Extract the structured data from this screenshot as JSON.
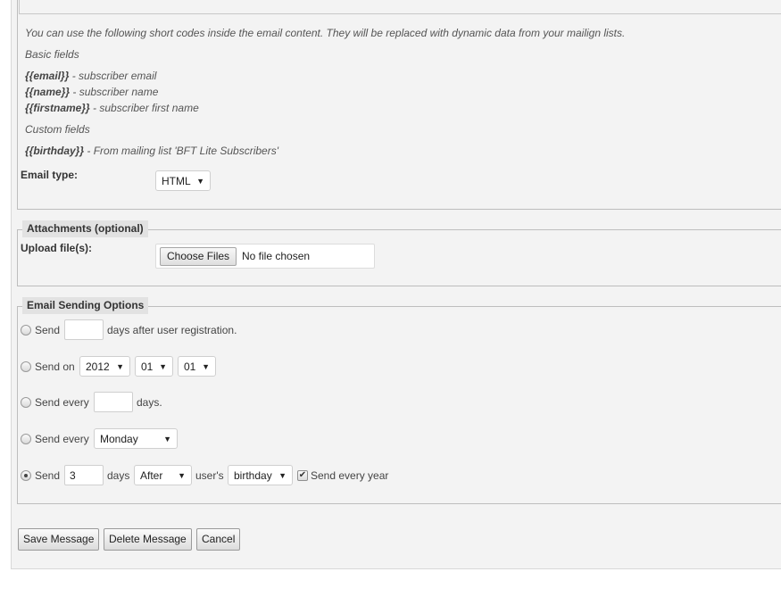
{
  "shortcodes": {
    "intro": "You can use the following short codes inside the email content. They will be replaced with dynamic data from your mailign lists.",
    "basic_heading": "Basic fields",
    "email_code": "{{email}}",
    "email_desc": " - subscriber email",
    "name_code": "{{name}}",
    "name_desc": " - subscriber name",
    "firstname_code": "{{firstname}}",
    "firstname_desc": " - subscriber first name",
    "custom_heading": "Custom fields",
    "birthday_code": "{{birthday}}",
    "birthday_desc": " - From mailing list 'BFT Lite Subscribers'"
  },
  "email_type": {
    "label": "Email type:",
    "value": "HTML"
  },
  "attachments": {
    "legend": "Attachments (optional)",
    "upload_label": "Upload file(s):",
    "choose_button": "Choose Files",
    "no_file": "No file chosen"
  },
  "sending": {
    "legend": "Email Sending Options",
    "opt1": {
      "send": "Send",
      "days_value": "",
      "suffix": "days after user registration.",
      "selected": false
    },
    "opt2": {
      "send_on": "Send on",
      "year": "2012",
      "month": "01",
      "day": "01",
      "selected": false
    },
    "opt3": {
      "send_every": "Send every",
      "days_value": "",
      "suffix": "days.",
      "selected": false
    },
    "opt4": {
      "send_every": "Send every",
      "weekday": "Monday",
      "selected": false
    },
    "opt5": {
      "send": "Send",
      "days_value": "3",
      "days": "days",
      "when": "After",
      "users": "user's",
      "field": "birthday",
      "every_year": "Send every year",
      "every_year_checked": true,
      "selected": true
    }
  },
  "buttons": {
    "save": "Save Message",
    "delete": "Delete Message",
    "cancel": "Cancel"
  }
}
